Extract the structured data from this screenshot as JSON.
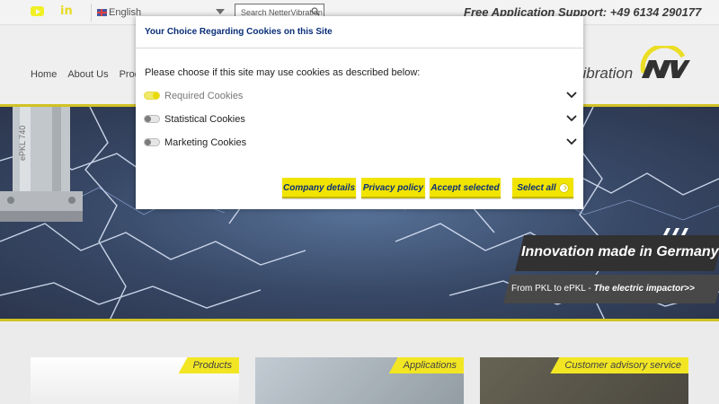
{
  "topbar": {
    "social": [
      "youtube-icon",
      "linkedin-icon"
    ],
    "linkedin_text": "in",
    "language": "English",
    "search_placeholder": "Search NetterVibration",
    "support_text": "Free Application Support: +49 6134 290177"
  },
  "nav": {
    "items": [
      "Home",
      "About Us",
      "Produ"
    ],
    "brand_word": "vibration",
    "logo_text": "NV"
  },
  "hero": {
    "product_label": "ePKL 740",
    "promo_title": "Innovation made in Germany",
    "promo_sub_prefix": "From PKL to ePKL - ",
    "promo_sub_link": "The electric impactor>>"
  },
  "cards": [
    {
      "tag": "Products"
    },
    {
      "tag": "Applications"
    },
    {
      "tag": "Customer advisory service"
    }
  ],
  "modal": {
    "title": "Your Choice Regarding Cookies on this Site",
    "intro": "Please choose if this site may use cookies as described below:",
    "cookies": [
      {
        "label": "Required Cookies",
        "enabled": true
      },
      {
        "label": "Statistical Cookies",
        "enabled": false
      },
      {
        "label": "Marketing Cookies",
        "enabled": false
      }
    ],
    "buttons": {
      "company_details": "Company details",
      "privacy_policy": "Privacy policy",
      "accept_selected": "Accept selected",
      "select_all": "Select all"
    }
  },
  "colors": {
    "accent_yellow": "#f1e400",
    "title_blue": "#0a2e79"
  }
}
